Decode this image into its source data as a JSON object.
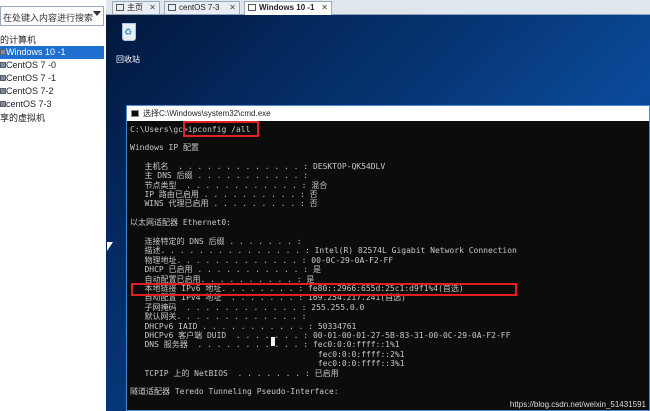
{
  "sidebar": {
    "search_text": "在处键入内容进行搜索",
    "root_label": "的计算机",
    "vms": [
      "Windows 10 -1",
      "CentOS 7 -0",
      "CentOS 7 -1",
      "CentOS 7-2",
      "centOS 7-3"
    ],
    "shared_label": "享的虚拟机"
  },
  "tabs": [
    {
      "label": "主页"
    },
    {
      "label": "centOS 7-3"
    },
    {
      "label": "Windows 10 -1"
    }
  ],
  "desktop": {
    "recycle_bin": "回收站"
  },
  "cmd": {
    "title": "选择C:\\Windows\\system32\\cmd.exe",
    "prompt": "C:\\Users\\gc>",
    "command": "ipconfig /all",
    "lines": [
      "Windows IP 配置",
      "",
      "   主机名  . . . . . . . . . . . . . : DESKTOP-QK54DLV",
      "   主 DNS 后缀 . . . . . . . . . . . :",
      "   节点类型  . . . . . . . . . . . . : 混合",
      "   IP 路由已启用 . . . . . . . . . . : 否",
      "   WINS 代理已启用 . . . . . . . . . : 否",
      "",
      "以太网适配器 Ethernet0:",
      "",
      "   连接特定的 DNS 后缀 . . . . . . . :",
      "   描述. . . . . . . . . . . . . . . : Intel(R) 82574L Gigabit Network Connection",
      "   物理地址. . . . . . . . . . . . . : 00-0C-29-0A-F2-FF",
      "   DHCP 已启用 . . . . . . . . . . . : 是",
      "   自动配置已启用. . . . . . . . . . : 是",
      "   本地链接 IPv6 地址. . . . . . . . : fe80::2966:655d:25c1:d9f1%4(首选)",
      "   自动配置 IPv4 地址  . . . . . . . : 169.254.217.241(首选)",
      "   子网掩码  . . . . . . . . . . . . : 255.255.0.0",
      "   默认网关. . . . . . . . . . . . . :",
      "   DHCPv6 IAID . . . . . . . . . . . : 50334761",
      "   DHCPv6 客户端 DUID  . . . . . . . : 00-01-00-01-27-5B-83-31-00-0C-29-0A-F2-FF",
      "   DNS 服务器  . . . . . . . . . . . : fec0:0:0:ffff::1%1",
      "                                       fec0:0:0:ffff::2%1",
      "                                       fec0:0:0:ffff::3%1",
      "   TCPIP 上的 NetBIOS  . . . . . . . : 已启用",
      "",
      "隧道适配器 Teredo Tunneling Pseudo-Interface:"
    ]
  },
  "watermark": "https://blog.csdn.net/weixin_51431591"
}
